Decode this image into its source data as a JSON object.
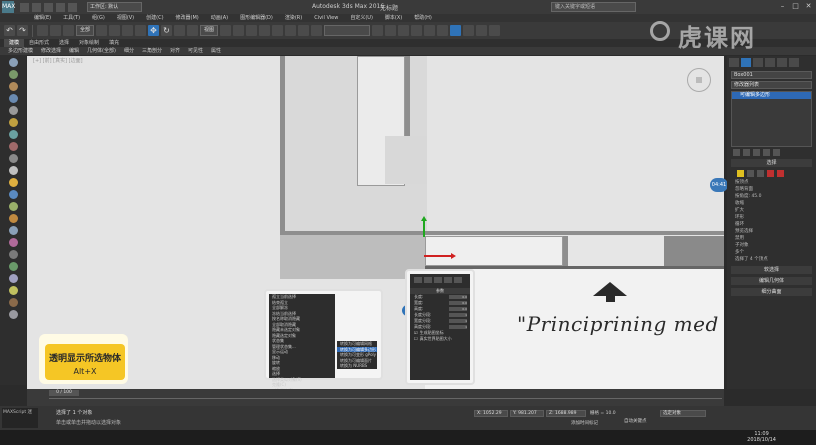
{
  "titlebar": {
    "logo": "MAX",
    "workspace": "工作区: 默认",
    "app_title": "Autodesk 3ds Max 2016",
    "doc_name": "无标题",
    "search_placeholder": "键入关键字或短语"
  },
  "menubar": {
    "items": [
      "编辑(E)",
      "工具(T)",
      "组(G)",
      "视图(V)",
      "创建(C)",
      "修改器(M)",
      "动画(A)",
      "图形编辑器(D)",
      "渲染(R)",
      "Civil View",
      "自定义(U)",
      "脚本(X)",
      "帮助(H)"
    ]
  },
  "toolbar": {
    "filter": "全部",
    "refcoord": "视图"
  },
  "ribbon": {
    "tabs": [
      "建模",
      "自由形式",
      "选择",
      "对象绘制",
      "填充"
    ],
    "sub": [
      "多边形建模",
      "修改选择",
      "编辑",
      "几何体(全部)",
      "细分",
      "三角剖分",
      "对齐",
      "可见性",
      "属性"
    ]
  },
  "viewport": {
    "label": "[+] [前] [真实] [边面]",
    "scene_text": "\"Principrining med t"
  },
  "caption": {
    "title": "透明显示所选物体",
    "shortcut": "Alt+X"
  },
  "quadmenu": {
    "items": [
      "孤立当前选择",
      "结束孤立",
      "全部解冻",
      "冻结当前选择",
      "按名称取消隐藏",
      "全部取消隐藏",
      "隐藏未选定对象",
      "隐藏选定对象",
      "状态集",
      "管理状态集...",
      "显示运动",
      "移动",
      "旋转",
      "缩放",
      "选择",
      "选择类似对象(S)",
      "克隆(C)",
      "对象属性(P)...",
      "曲线编辑器...",
      "摄影表...",
      "连线参数...",
      "转换为:",
      "V-Ray 属性",
      "V-Ray 场景转换器",
      "V-Ray 网格导出",
      "V-Ray 虚拟帧缓冲区",
      "V-Ray 场景文件导出器"
    ],
    "highlight_index": 21,
    "sub": [
      "转换为可编辑网格",
      "转换为可编辑多边形",
      "转换为可变形 gPoly",
      "转换为可编辑面片",
      "转换为 NURBS"
    ],
    "sub_highlight_index": 1
  },
  "polypanel": {
    "title": "参数",
    "rows": [
      {
        "label": "长度:",
        "value": "0.0"
      },
      {
        "label": "宽度:",
        "value": "0.0"
      },
      {
        "label": "高度:",
        "value": "0.0"
      },
      {
        "label": "长度分段:",
        "value": "1"
      },
      {
        "label": "宽度分段:",
        "value": "1"
      },
      {
        "label": "高度分段:",
        "value": "1"
      }
    ],
    "checks": [
      "生成贴图坐标",
      "真实世界贴图大小"
    ]
  },
  "cmdpanel": {
    "object_name": "Box001",
    "modifier_list": "修改器列表",
    "stack_item": "可编辑多边形",
    "rollouts": [
      "选择",
      "软选择",
      "编辑几何体",
      "细分曲面"
    ],
    "selection_lines": [
      "按顶点",
      "忽略背面",
      "按角度: 45.0",
      "收缩",
      "扩大",
      "环形",
      "循环",
      "预览选择",
      "禁用",
      "子对象",
      "多个",
      "选择了 4 个顶点"
    ],
    "badge": "04:41"
  },
  "timeline": {
    "slider": "0 / 100"
  },
  "status": {
    "script": "MAXScript 迷",
    "line1": "选择了 1 个对象",
    "line2": "单击或单击并拖动以选择对象",
    "x": "X: 1052.29",
    "y": "Y: 981.207",
    "z": "Z: 1688.989",
    "grid": "栅格 = 10.0",
    "autokey": "自动关键点",
    "selected": "选定对象",
    "add_time": "添加时间标记"
  },
  "taskbar": {
    "time": "11:09",
    "date": "2018/10/14"
  },
  "watermark": {
    "text": "虎课网"
  },
  "colors": {
    "accent": "#2f73b8",
    "caption_bg": "#f5c625",
    "viewport_bg": "#e4e4e4"
  }
}
